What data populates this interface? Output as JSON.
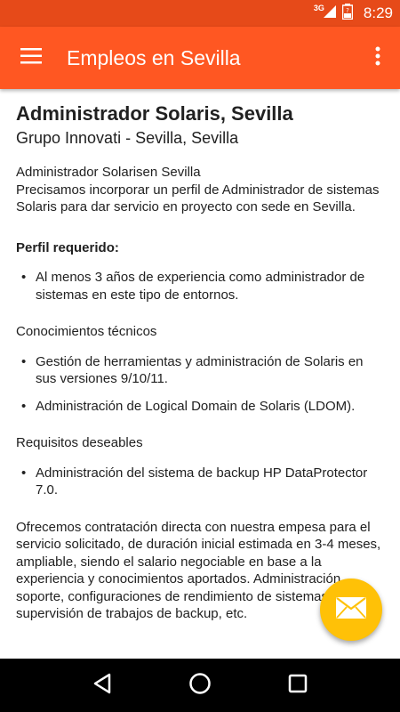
{
  "status_bar": {
    "network": "3G",
    "time": "8:29"
  },
  "app_bar": {
    "title": "Empleos en Sevilla"
  },
  "job": {
    "title": "Administrador Solaris, Sevilla",
    "company": "Grupo Innovati - Sevilla, Sevilla",
    "intro_line1": "Administrador Solarisen Sevilla",
    "intro_line2": "Precisamos incorporar un perfil de Administrador de sistemas Solaris para dar servicio en proyecto con sede en Sevilla.",
    "profile_heading": "Perfil requerido:",
    "profile_items": [
      "Al menos 3 años de experiencia como administrador de sistemas en este tipo de entornos."
    ],
    "knowledge_heading": "Conocimientos técnicos",
    "knowledge_items": [
      "Gestión de herramientas y administración de Solaris en sus versiones 9/10/11.",
      "Administración de Logical Domain de Solaris (LDOM)."
    ],
    "desired_heading": "Requisitos deseables",
    "desired_items": [
      "Administración del sistema de backup HP DataProtector 7.0."
    ],
    "offer": "Ofrecemos contratación directa con nuestra empesa para el servicio solicitado, de duración inicial estimada en 3-4 meses, ampliable, siendo el salario negociable en base a la experiencia y conocimientos aportados. Administración, soporte, configuraciones de rendimiento de sistemas, supervisión de trabajos de backup, etc."
  },
  "colors": {
    "status_bar": "#e64a19",
    "app_bar": "#ff5722",
    "fab": "#ffc107",
    "nav_bar": "#000000"
  },
  "icons": {
    "menu": "hamburger-menu-icon",
    "overflow": "more-vert-icon",
    "fab": "mail-icon",
    "back": "back-triangle-icon",
    "home": "home-circle-icon",
    "recents": "recents-square-icon"
  }
}
